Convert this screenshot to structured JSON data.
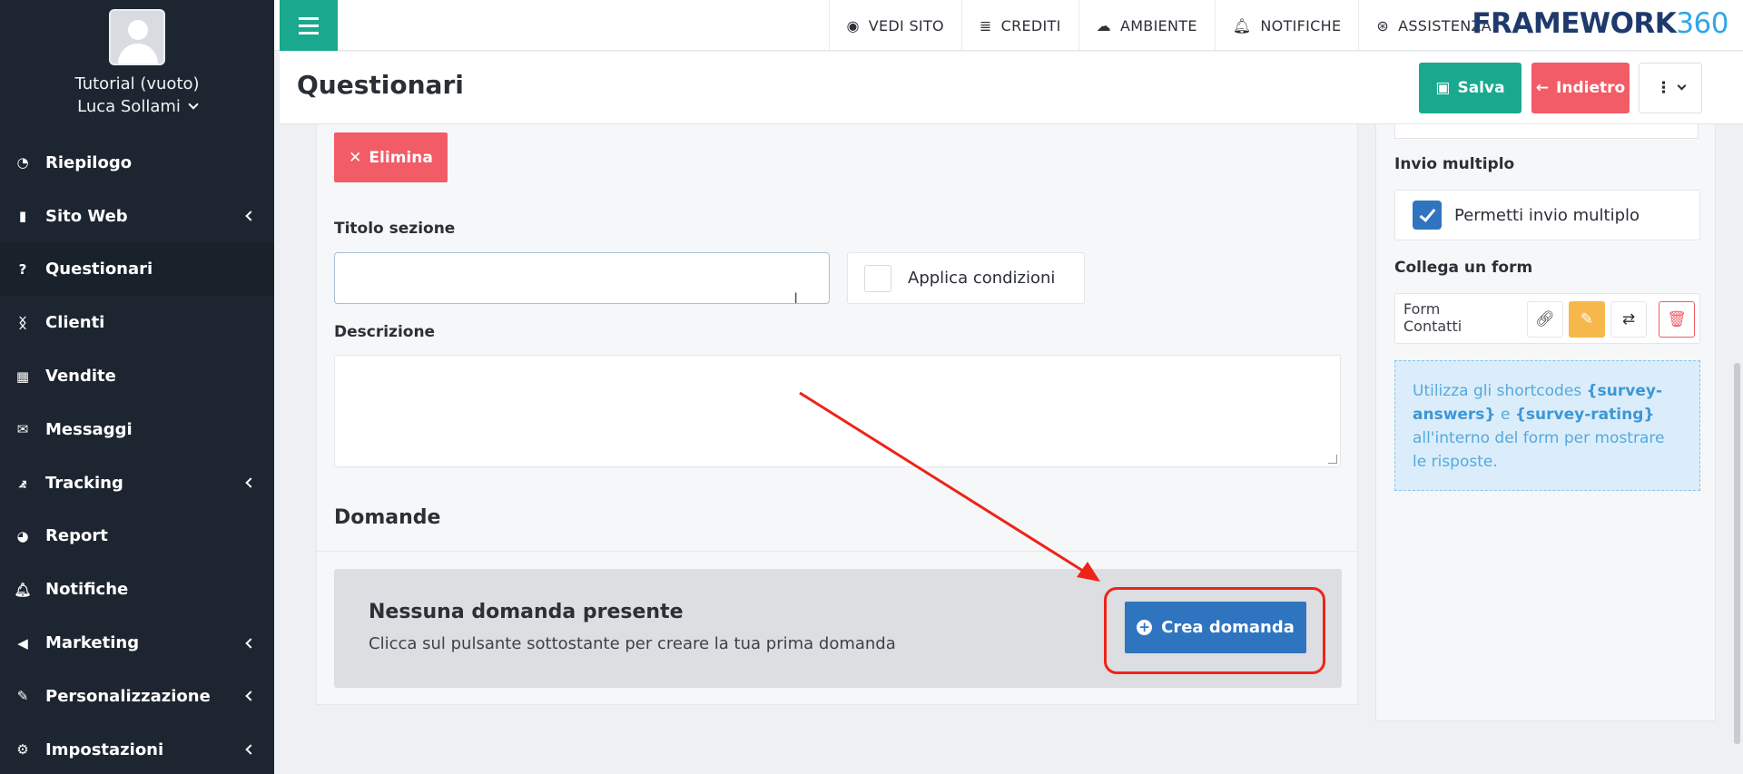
{
  "sidebar": {
    "profile_name": "Tutorial (vuoto)",
    "user_name": "Luca Sollami",
    "items": [
      {
        "label": "Riepilogo",
        "icon": "dashboard-icon",
        "has_submenu": false
      },
      {
        "label": "Sito Web",
        "icon": "file-icon",
        "has_submenu": true
      },
      {
        "label": "Questionari",
        "icon": "question-icon",
        "has_submenu": false
      },
      {
        "label": "Clienti",
        "icon": "person-icon",
        "has_submenu": false
      },
      {
        "label": "Vendite",
        "icon": "calculator-icon",
        "has_submenu": false
      },
      {
        "label": "Messaggi",
        "icon": "envelope-icon",
        "has_submenu": false
      },
      {
        "label": "Tracking",
        "icon": "chart-icon",
        "has_submenu": true
      },
      {
        "label": "Report",
        "icon": "pie-icon",
        "has_submenu": false
      },
      {
        "label": "Notifiche",
        "icon": "bell-icon",
        "has_submenu": false
      },
      {
        "label": "Marketing",
        "icon": "megaphone-icon",
        "has_submenu": true
      },
      {
        "label": "Personalizzazione",
        "icon": "brush-icon",
        "has_submenu": true
      },
      {
        "label": "Impostazioni",
        "icon": "gear-icon",
        "has_submenu": true
      }
    ]
  },
  "topnav": {
    "items": [
      {
        "label": "VEDI SITO",
        "icon": "eye-icon"
      },
      {
        "label": "CREDITI",
        "icon": "coins-icon"
      },
      {
        "label": "AMBIENTE",
        "icon": "cloud-icon"
      },
      {
        "label": "NOTIFICHE",
        "icon": "bell-icon"
      },
      {
        "label": "ASSISTENZA",
        "icon": "lifebuoy-icon"
      }
    ],
    "brand": "FRAMEWORK",
    "brand_num": "360"
  },
  "header": {
    "title": "Questionari",
    "save_label": "Salva",
    "back_label": "Indietro"
  },
  "section": {
    "delete_label": "Elimina",
    "title_label": "Titolo sezione",
    "title_value": "",
    "conditions_label": "Applica condizioni",
    "description_label": "Descrizione",
    "description_value": "",
    "questions_heading": "Domande",
    "empty_title": "Nessuna domanda presente",
    "empty_subtitle": "Clicca sul pulsante sottostante per creare la tua prima domanda",
    "create_label": "Crea domanda"
  },
  "right_panel": {
    "multi_label": "Invio multiplo",
    "multi_checkbox_label": "Permetti invio multiplo",
    "multi_checked": true,
    "link_form_label": "Collega un form",
    "form_name": "Form Contatti",
    "info_pre": "Utilizza gli shortcodes ",
    "info_code1": "{survey-answers}",
    "info_mid": " e ",
    "info_code2": "{survey-rating}",
    "info_post": " all'interno del form per mostrare le risposte."
  },
  "colors": {
    "sidebar_bg": "#1d2530",
    "primary_green": "#1aa98f",
    "danger_red": "#f25c66",
    "primary_blue": "#2f74bf",
    "warning_orange": "#f7b84b",
    "annotation_red": "#ec2418"
  }
}
